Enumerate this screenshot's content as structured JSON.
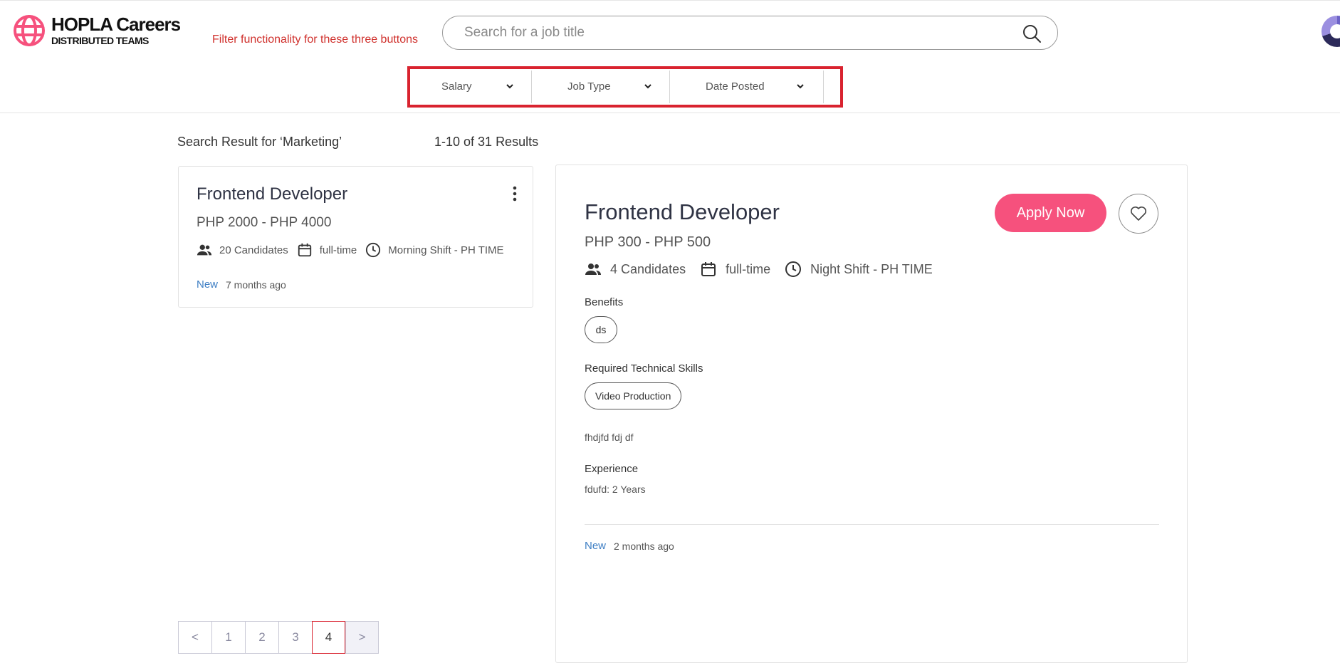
{
  "brand": {
    "title": "HOPLA Careers",
    "subtitle": "DISTRIBUTED TEAMS"
  },
  "annotation": "Filter functionality for these three buttons",
  "search": {
    "placeholder": "Search for a job title",
    "value": ""
  },
  "filters": [
    {
      "label": "Salary"
    },
    {
      "label": "Job Type"
    },
    {
      "label": "Date Posted"
    }
  ],
  "results": {
    "label": "Search Result for ‘Marketing’",
    "count": "1-10 of 31 Results"
  },
  "job_card": {
    "title": "Frontend Developer",
    "salary": "PHP 2000 - PHP 4000",
    "candidates": "20 Candidates",
    "type": "full-time",
    "shift": "Morning Shift - PH TIME",
    "badge": "New",
    "posted": "7 months ago"
  },
  "pagination": [
    "<",
    "1",
    "2",
    "3",
    "4",
    ">"
  ],
  "pagination_active": "4",
  "detail": {
    "title": "Frontend Developer",
    "salary": "PHP 300 - PHP 500",
    "candidates": "4 Candidates",
    "type": "full-time",
    "shift": "Night Shift - PH TIME",
    "apply_label": "Apply Now",
    "benefits_label": "Benefits",
    "benefits": [
      "ds"
    ],
    "skills_label": "Required Technical Skills",
    "skills": [
      "Video Production"
    ],
    "description": "fhdjfd fdj df",
    "experience_label": "Experience",
    "experience": "fdufd: 2 Years",
    "badge": "New",
    "posted": "2 months ago"
  },
  "colors": {
    "accent": "#f6517d",
    "highlight": "#d9232f",
    "annotation": "#d0312d",
    "link": "#3f7fc4"
  }
}
